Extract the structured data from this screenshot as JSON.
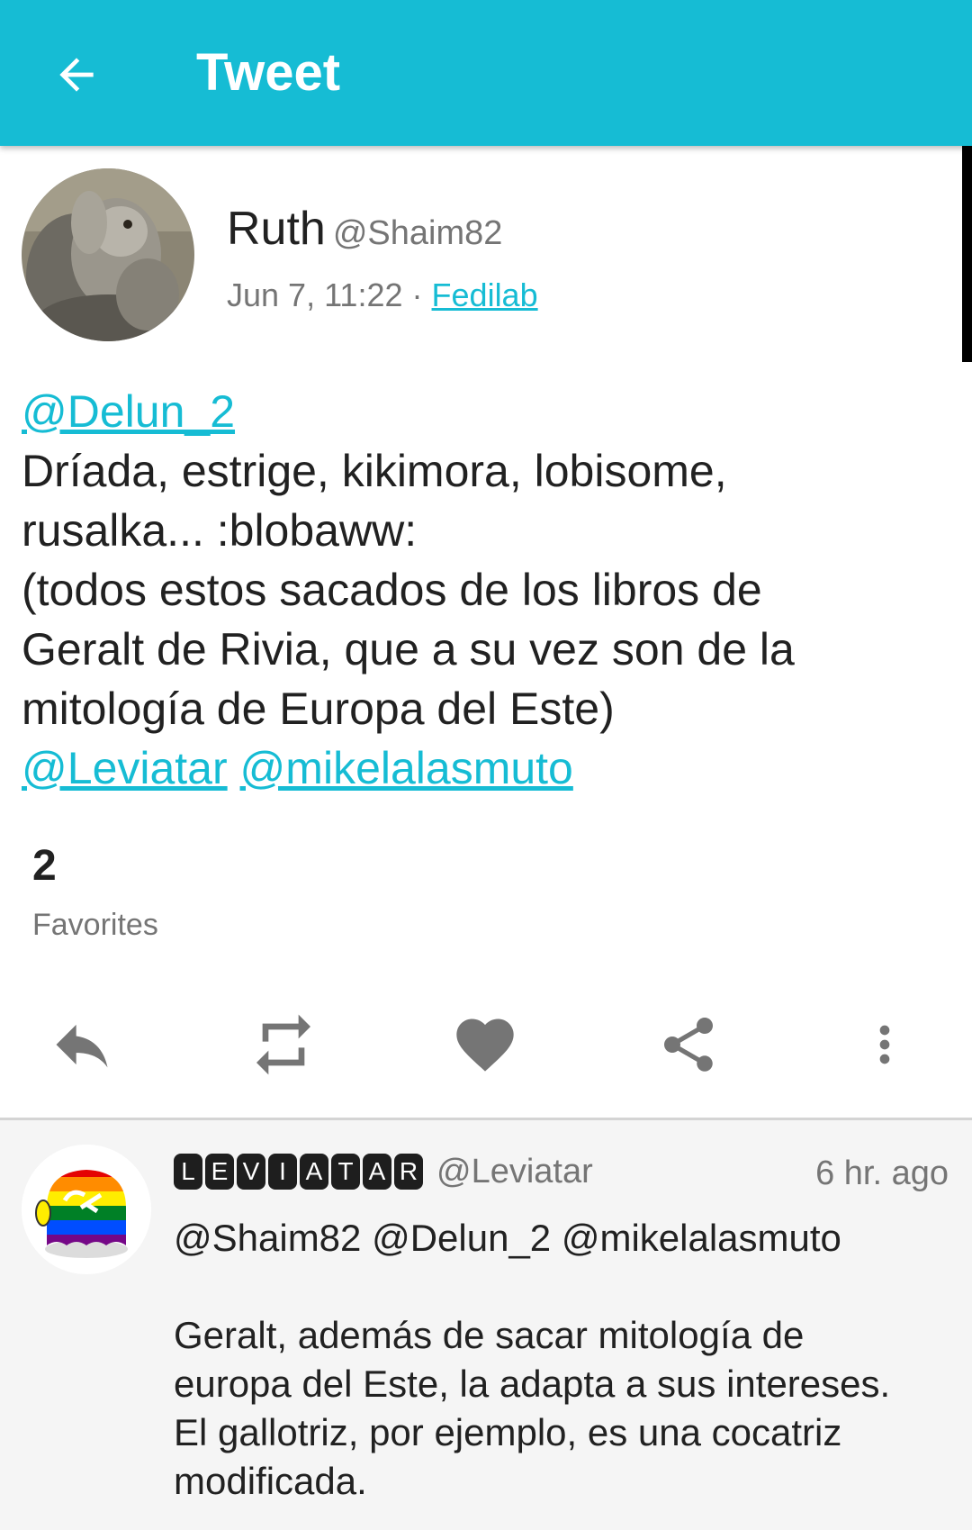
{
  "appbar": {
    "title": "Tweet"
  },
  "status": {
    "author_name": "Ruth",
    "author_handle": "@Shaim82",
    "date": "Jun 7, 11:22",
    "separator": "·",
    "app": "Fedilab",
    "mention_top": "@Delun_2",
    "text_lines": [
      "Dríada, estrige, kikimora, lobisome,",
      "rusalka... :blobaww:",
      "(todos estos sacados de los libros de",
      "Geralt de Rivia, que a su vez son de la",
      "mitología de Europa del Este)"
    ],
    "mentions_bottom": [
      "@Leviatar",
      "@mikelalasmuto"
    ],
    "favorites_count": "2",
    "favorites_label": "Favorites"
  },
  "actions": {
    "reply_icon": "reply-icon",
    "boost_icon": "retweet-icon",
    "favorite_icon": "heart-icon",
    "share_icon": "share-icon",
    "more_icon": "more-vert-icon"
  },
  "reply": {
    "display_letters": [
      "L",
      "E",
      "V",
      "I",
      "A",
      "T",
      "A",
      "R"
    ],
    "handle": "@Leviatar",
    "time": "6 hr. ago",
    "text_lines_1": [
      "@Shaim82 @Delun_2 @mikelalasmuto"
    ],
    "text_lines_2": [
      "Geralt, además de sacar mitología de",
      "europa del Este, la adapta a sus intereses.",
      "El gallotriz, por ejemplo, es una cocatriz",
      "modificada."
    ]
  },
  "colors": {
    "accent": "#16bcd4",
    "icon_gray": "#757575"
  }
}
